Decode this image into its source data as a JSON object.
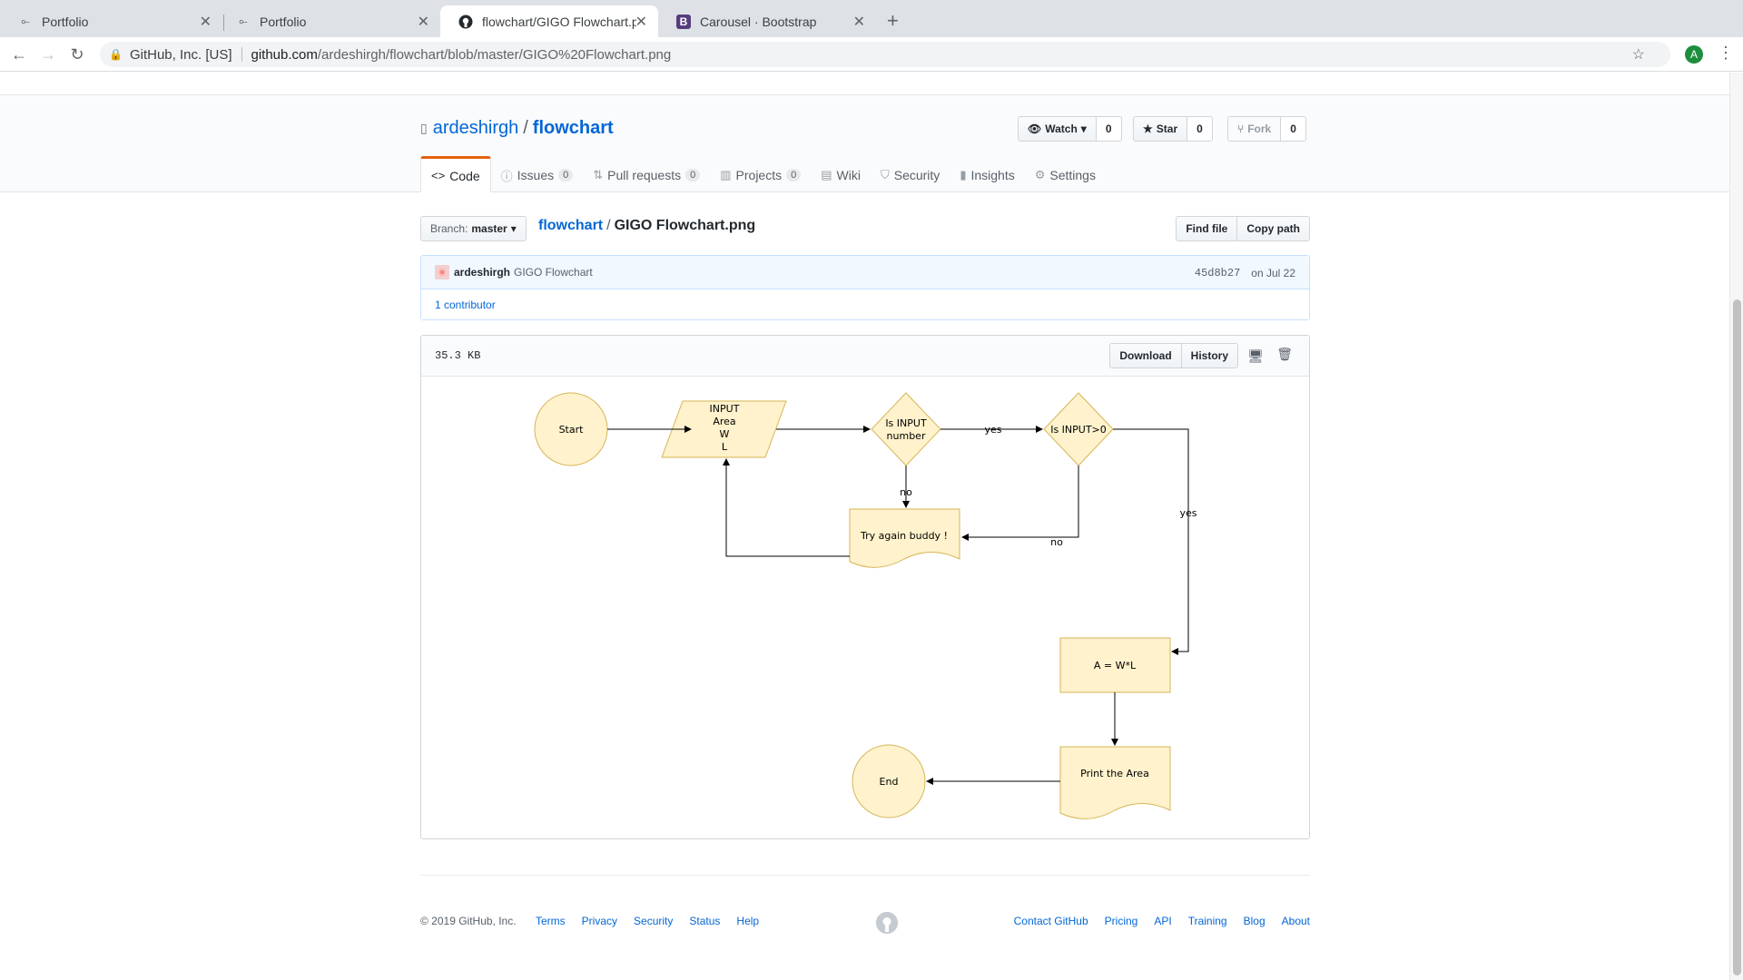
{
  "browser": {
    "tabs": [
      {
        "title": "Portfolio",
        "icon": "portfolio-favicon"
      },
      {
        "title": "Portfolio",
        "icon": "portfolio-favicon"
      },
      {
        "title": "flowchart/GIGO Flowchart.png",
        "icon": "github-favicon"
      },
      {
        "title": "Carousel · Bootstrap",
        "icon": "bootstrap-favicon"
      }
    ],
    "active_tab": 2,
    "omnibox": {
      "org": "GitHub, Inc. [US]",
      "host": "github.com",
      "path": "/ardeshirgh/flowchart/blob/master/GIGO%20Flowchart.png"
    },
    "profile_initial": "A"
  },
  "repo": {
    "owner": "ardeshirgh",
    "name": "flowchart",
    "watch_label": "Watch",
    "watch_count": "0",
    "star_label": "Star",
    "star_count": "0",
    "fork_label": "Fork",
    "fork_count": "0"
  },
  "reponav": [
    {
      "label": "Code",
      "icon": "code-icon"
    },
    {
      "label": "Issues",
      "icon": "issue-icon",
      "count": "0"
    },
    {
      "label": "Pull requests",
      "icon": "pull-request-icon",
      "count": "0"
    },
    {
      "label": "Projects",
      "icon": "project-icon",
      "count": "0"
    },
    {
      "label": "Wiki",
      "icon": "book-icon"
    },
    {
      "label": "Security",
      "icon": "shield-icon"
    },
    {
      "label": "Insights",
      "icon": "graph-icon"
    },
    {
      "label": "Settings",
      "icon": "gear-icon"
    }
  ],
  "filenav": {
    "branch_label": "Branch:",
    "branch_value": "master",
    "crumb_repo": "flowchart",
    "crumb_sep": "/",
    "crumb_file": "GIGO Flowchart.png",
    "find_file": "Find file",
    "copy_path": "Copy path"
  },
  "commit": {
    "author": "ardeshirgh",
    "message": "GIGO Flowchart",
    "sha": "45d8b27",
    "date": "on Jul 22",
    "contributors": "1 contributor"
  },
  "file": {
    "size": "35.3 KB",
    "download": "Download",
    "history": "History"
  },
  "flowchart": {
    "start": "Start",
    "input_lines": [
      "INPUT",
      "Area",
      "W",
      "L"
    ],
    "is_number_lines": [
      "Is INPUT",
      "number"
    ],
    "is_positive": "Is INPUT>0",
    "yes": "yes",
    "no": "no",
    "try_again": "Try again buddy !",
    "compute": "A = W*L",
    "print": "Print the Area",
    "end": "End"
  },
  "footer": {
    "copyright": "© 2019 GitHub, Inc.",
    "left_links": [
      "Terms",
      "Privacy",
      "Security",
      "Status",
      "Help"
    ],
    "right_links": [
      "Contact GitHub",
      "Pricing",
      "API",
      "Training",
      "Blog",
      "About"
    ]
  },
  "colors": {
    "accent": "#0366d6",
    "tab_underline": "#e36209",
    "shape_fill": "#fff2cc",
    "shape_stroke": "#d6b656"
  }
}
